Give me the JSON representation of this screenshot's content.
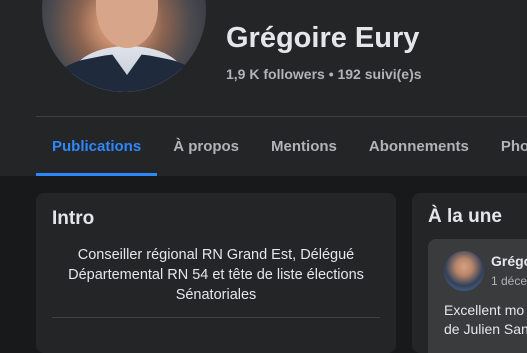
{
  "profile": {
    "name": "Grégoire Eury",
    "stats": "1,9 K followers • 192 suivi(e)s"
  },
  "tabs": [
    {
      "label": "Publications",
      "active": true
    },
    {
      "label": "À propos",
      "active": false
    },
    {
      "label": "Mentions",
      "active": false
    },
    {
      "label": "Abonnements",
      "active": false
    },
    {
      "label": "Photos",
      "active": false
    }
  ],
  "intro": {
    "title": "Intro",
    "bio": "Conseiller régional RN Grand Est, Délégué Départemental RN 54 et tête de liste élections Sénatoriales"
  },
  "featured": {
    "title": "À la une",
    "post": {
      "author": "Grégo",
      "date": "1 déce",
      "text_line1": "Excellent mo",
      "text_line2": "de Julien San"
    }
  },
  "colors": {
    "accent": "#2d88ff",
    "background": "#18191a",
    "card": "#242526"
  }
}
